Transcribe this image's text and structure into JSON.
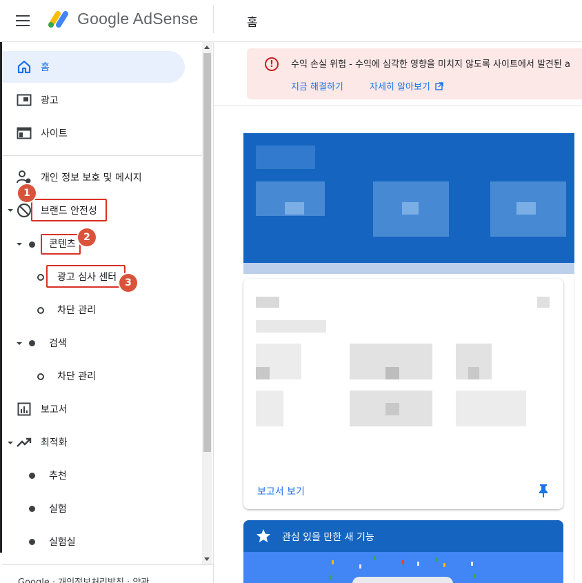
{
  "header": {
    "brand": "Google AdSense",
    "page_title": "홈"
  },
  "sidebar": {
    "items": [
      {
        "id": "home",
        "label": "홈",
        "icon": "home-icon",
        "active": true
      },
      {
        "id": "ads",
        "label": "광고",
        "icon": "ads-icon"
      },
      {
        "id": "sites",
        "label": "사이트",
        "icon": "sites-icon"
      },
      {
        "id": "privacy",
        "label": "개인 정보 보호 및 메시지",
        "icon": "privacy-messaging-icon"
      },
      {
        "id": "brand-safety",
        "label": "브랜드 안전성",
        "icon": "block-icon",
        "expanded": true
      },
      {
        "id": "content",
        "label": "콘텐츠",
        "expanded": true
      },
      {
        "id": "ad-review-center",
        "label": "광고 심사 센터"
      },
      {
        "id": "blocking-controls-content",
        "label": "차단 관리"
      },
      {
        "id": "search",
        "label": "검색",
        "expanded": true
      },
      {
        "id": "blocking-controls-search",
        "label": "차단 관리"
      },
      {
        "id": "reports",
        "label": "보고서",
        "icon": "reports-icon"
      },
      {
        "id": "optimization",
        "label": "최적화",
        "icon": "trending-up-icon",
        "expanded": true
      },
      {
        "id": "recommendations",
        "label": "추천"
      },
      {
        "id": "experiments",
        "label": "실험"
      },
      {
        "id": "labs",
        "label": "실험실"
      }
    ],
    "footer": "Google · 개인정보처리방침 · 약관"
  },
  "annotations": {
    "badge1": "1",
    "badge2": "2",
    "badge3": "3"
  },
  "alert": {
    "message": "수익 손실 위험 - 수익에 심각한 영향을 미치지 않도록 사이트에서 발견된 a",
    "fix_now": "지금 해결하기",
    "learn_more": "자세히 알아보기"
  },
  "stat_card": {
    "link": "보고서 보기"
  },
  "feature_card": {
    "title": "관심 있을 만한 새 기능"
  },
  "colors": {
    "accent": "#1a73e8",
    "active_bg": "#e8f0fe",
    "alert_bg": "#fce8e6",
    "alert_icon": "#c5221f",
    "highlight": "#d93025",
    "badge": "#d9533a",
    "card_blue": "#1565c0"
  }
}
